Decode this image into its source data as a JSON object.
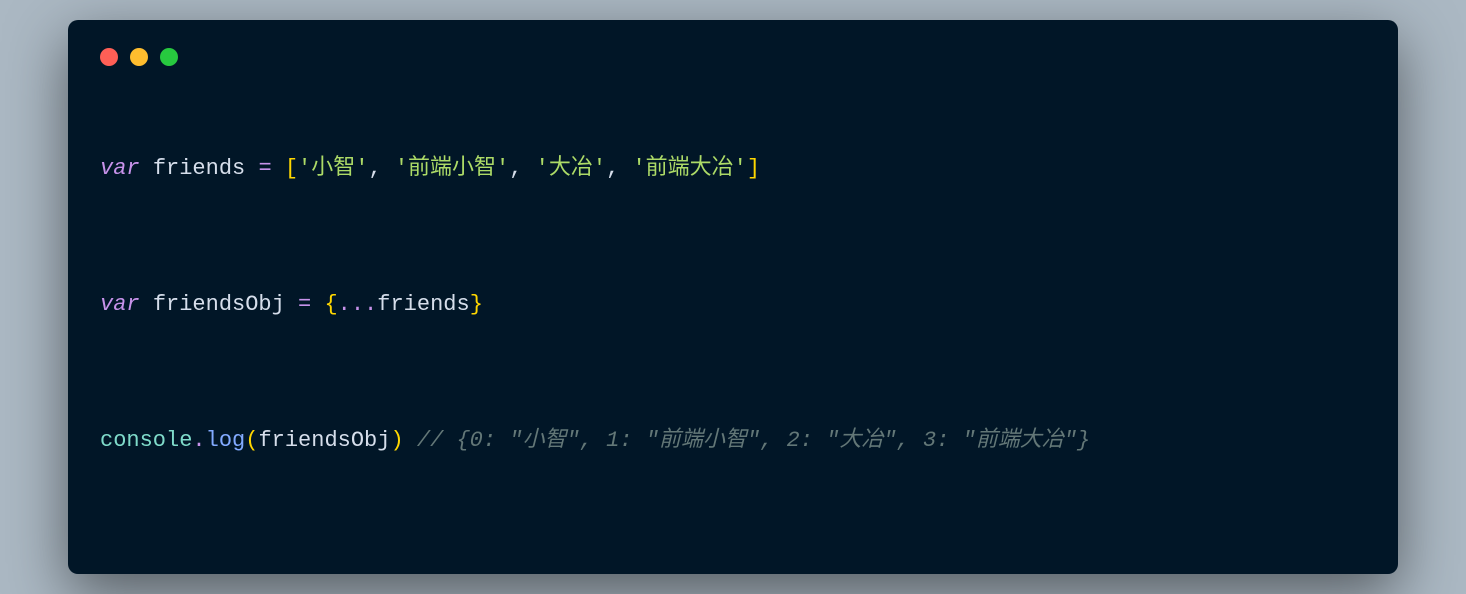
{
  "window": {
    "traffic_colors": {
      "red": "#ff5f56",
      "yellow": "#ffbd2e",
      "green": "#27c93f"
    }
  },
  "code": {
    "line1": {
      "kw": "var",
      "ident": "friends",
      "eq": "=",
      "open": "[",
      "s1": "'小智'",
      "c1": ",",
      "s2": "'前端小智'",
      "c2": ",",
      "s3": "'大冶'",
      "c3": ",",
      "s4": "'前端大冶'",
      "close": "]"
    },
    "line2": {
      "kw": "var",
      "ident": "friendsObj",
      "eq": "=",
      "open": "{",
      "spread": "...",
      "src": "friends",
      "close": "}"
    },
    "line3": {
      "obj": "console",
      "dot": ".",
      "method": "log",
      "open": "(",
      "arg": "friendsObj",
      "close": ")",
      "sp": " ",
      "comment": "// {0: \"小智\", 1: \"前端小智\", 2: \"大冶\", 3: \"前端大冶\"}"
    }
  }
}
